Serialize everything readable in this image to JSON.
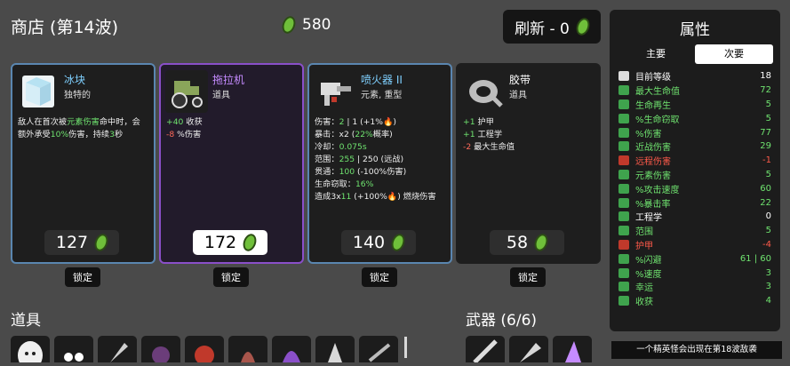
{
  "header": {
    "title": "商店 (第14波)",
    "materials": "580",
    "refresh_label": "刷新 - 0"
  },
  "cards": [
    {
      "name": "冰块",
      "type": "独特的",
      "price": "127",
      "lock": "锁定",
      "desc": [
        "敌人在首次被元素伤害命中时，会",
        "额外承受10%伤害，持续3秒"
      ]
    },
    {
      "name": "拖拉机",
      "type": "道具",
      "price": "172",
      "lock": "锁定",
      "desc": [
        "+40 收获",
        "-8 %伤害"
      ]
    },
    {
      "name": "喷火器 II",
      "type": "元素, 重型",
      "price": "140",
      "lock": "锁定",
      "desc": [
        "伤害：2 | 1 (+1%🔥)",
        "暴击：x2 (22%概率)",
        "冷却：0.075s",
        "范围：255 | 250 (远战)",
        "贯通：100 (-100%伤害)",
        "生命窃取：16%",
        "造成3x11 (+100%🔥) 燃烧伤害"
      ]
    },
    {
      "name": "胶带",
      "type": "道具",
      "price": "58",
      "lock": "锁定",
      "desc": [
        "+1 护甲",
        "+1 工程学",
        "-2 最大生命值"
      ]
    }
  ],
  "sections": {
    "items": "道具",
    "weapons": "武器 (6/6)"
  },
  "panel": {
    "title": "属性",
    "tabs": [
      "主要",
      "次要"
    ],
    "stats": [
      {
        "label": "目前等级",
        "value": "18",
        "color": "#ffffff",
        "icon": "level-icon"
      },
      {
        "label": "最大生命值",
        "value": "72",
        "color": "#6fe36f",
        "icon": "heart-icon"
      },
      {
        "label": "生命再生",
        "value": "5",
        "color": "#6fe36f",
        "icon": "regen-icon"
      },
      {
        "label": "%生命窃取",
        "value": "5",
        "color": "#6fe36f",
        "icon": "lifesteal-icon"
      },
      {
        "label": "%伤害",
        "value": "77",
        "color": "#6fe36f",
        "icon": "damage-icon"
      },
      {
        "label": "近战伤害",
        "value": "29",
        "color": "#6fe36f",
        "icon": "melee-icon"
      },
      {
        "label": "远程伤害",
        "value": "-1",
        "color": "#ff5a4a",
        "icon": "ranged-icon"
      },
      {
        "label": "元素伤害",
        "value": "5",
        "color": "#6fe36f",
        "icon": "elemental-icon"
      },
      {
        "label": "%攻击速度",
        "value": "60",
        "color": "#6fe36f",
        "icon": "attack-speed-icon"
      },
      {
        "label": "%暴击率",
        "value": "22",
        "color": "#6fe36f",
        "icon": "crit-icon"
      },
      {
        "label": "工程学",
        "value": "0",
        "color": "#ffffff",
        "icon": "engineering-icon"
      },
      {
        "label": "范围",
        "value": "5",
        "color": "#6fe36f",
        "icon": "range-icon"
      },
      {
        "label": "护甲",
        "value": "-4",
        "color": "#ff5a4a",
        "icon": "armor-icon"
      },
      {
        "label": "%闪避",
        "value": "61 | 60",
        "color": "#6fe36f",
        "icon": "dodge-icon"
      },
      {
        "label": "%速度",
        "value": "3",
        "color": "#6fe36f",
        "icon": "speed-icon"
      },
      {
        "label": "幸运",
        "value": "3",
        "color": "#6fe36f",
        "icon": "luck-icon"
      },
      {
        "label": "收获",
        "value": "4",
        "color": "#6fe36f",
        "icon": "harvest-icon"
      }
    ]
  },
  "banner": "一个精英怪会出现在第18波敌袭"
}
